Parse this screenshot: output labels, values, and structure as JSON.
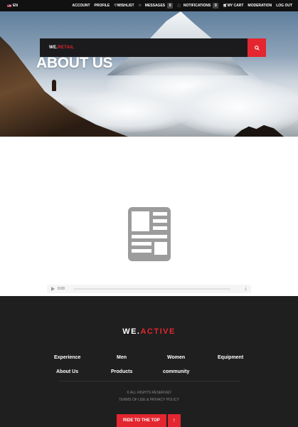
{
  "topbar": {
    "language": "EN",
    "nav": {
      "account": "ACCOUNT",
      "profile": "PROFILE",
      "wishlist": "WISHLIST",
      "messages": "MESSAGES",
      "messages_count": "0",
      "notifications": "NOTIFICATIONS",
      "notifications_count": "0",
      "cart": "MY CART",
      "moderation": "MODERATION",
      "logout": "LOG OUT"
    }
  },
  "search": {
    "brand_prefix": "WE.",
    "brand_suffix": "RETAIL"
  },
  "hero": {
    "title": "ABOUT US"
  },
  "media": {
    "time": "0:00"
  },
  "footer": {
    "logo_prefix": "WE.",
    "logo_suffix": "ACTIVE",
    "links": [
      "Experience",
      "Men",
      "Women",
      "Equipment",
      "About Us",
      "Products",
      "community"
    ],
    "copyright": "© ALL RIGHTS RESERVED",
    "terms": "TERMS OF USE & PRIVACY POLICY",
    "totop": "RIDE TO THE TOP",
    "totop_arrow": "↑"
  },
  "colors": {
    "accent": "#e3262f",
    "footer_bg": "#1f1f1f",
    "topbar_bg": "#111111"
  },
  "icons": [
    "us-flag-icon",
    "heart-icon",
    "envelope-icon",
    "bell-icon",
    "cart-icon",
    "search-icon",
    "document-placeholder-icon",
    "play-icon",
    "download-icon",
    "arrow-up-icon"
  ]
}
